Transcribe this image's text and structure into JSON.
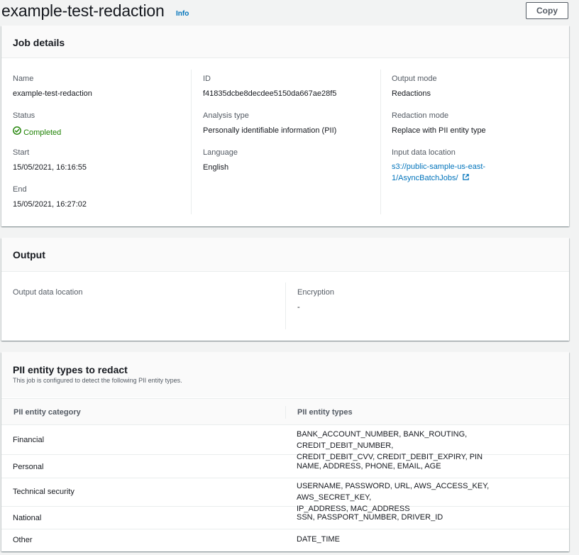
{
  "header": {
    "title": "example-test-redaction",
    "info_label": "Info",
    "copy_label": "Copy"
  },
  "job_details": {
    "title": "Job details",
    "name_label": "Name",
    "name_value": "example-test-redaction",
    "status_label": "Status",
    "status_value": "Completed",
    "start_label": "Start",
    "start_value": "15/05/2021, 16:16:55",
    "end_label": "End",
    "end_value": "15/05/2021, 16:27:02",
    "id_label": "ID",
    "id_value": "f41835dcbe8decdee5150da667ae28f5",
    "analysis_label": "Analysis type",
    "analysis_value": "Personally identifiable information (PII)",
    "language_label": "Language",
    "language_value": "English",
    "output_mode_label": "Output mode",
    "output_mode_value": "Redactions",
    "redaction_mode_label": "Redaction mode",
    "redaction_mode_value": "Replace with PII entity type",
    "input_location_label": "Input data location",
    "input_location_line1": "s3://public-sample-us-east-",
    "input_location_line2": "1/AsyncBatchJobs/"
  },
  "output": {
    "title": "Output",
    "location_label": "Output data location",
    "encryption_label": "Encryption",
    "encryption_value": "-"
  },
  "pii": {
    "title": "PII entity types to redact",
    "description": "This job is configured to detect the following PII entity types.",
    "columns": [
      "PII entity category",
      "PII entity types"
    ],
    "rows": [
      {
        "category": "Financial",
        "types_line1": "BANK_ACCOUNT_NUMBER, BANK_ROUTING, CREDIT_DEBIT_NUMBER,",
        "types_line2": "CREDIT_DEBIT_CVV, CREDIT_DEBIT_EXPIRY, PIN"
      },
      {
        "category": "Personal",
        "types_line1": "NAME, ADDRESS, PHONE, EMAIL, AGE",
        "types_line2": ""
      },
      {
        "category": "Technical security",
        "types_line1": "USERNAME, PASSWORD, URL, AWS_ACCESS_KEY, AWS_SECRET_KEY,",
        "types_line2": "IP_ADDRESS, MAC_ADDRESS"
      },
      {
        "category": "National",
        "types_line1": "SSN, PASSPORT_NUMBER, DRIVER_ID",
        "types_line2": ""
      },
      {
        "category": "Other",
        "types_line1": "DATE_TIME",
        "types_line2": ""
      }
    ]
  },
  "colors": {
    "link": "#0073bb",
    "success": "#1d8102",
    "text": "#16191f",
    "label": "#545b64"
  },
  "icons": {
    "status": "check-circle-icon",
    "external": "external-link-icon"
  }
}
